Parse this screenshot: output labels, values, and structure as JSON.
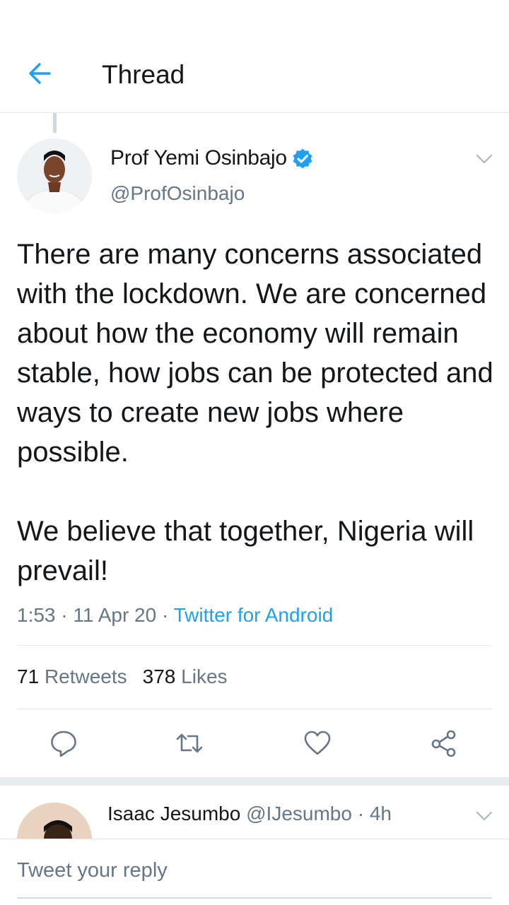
{
  "header": {
    "title": "Thread"
  },
  "tweet": {
    "author": {
      "name": "Prof Yemi Osinbajo",
      "handle": "@ProfOsinbajo",
      "verified": true
    },
    "paragraphs": [
      "There are many concerns associated with the lockdown. We are concerned about how the economy will remain stable, how jobs can be protected and ways to create new jobs where possible.",
      "We believe that together, Nigeria will prevail!"
    ],
    "meta": {
      "time": "1:53",
      "date": "11 Apr 20",
      "source": "Twitter for Android",
      "separator": "·"
    },
    "stats": {
      "retweets_count": "71",
      "retweets_label": "Retweets",
      "likes_count": "378",
      "likes_label": "Likes"
    },
    "actions": [
      "reply-icon",
      "retweet-icon",
      "like-icon",
      "share-icon"
    ]
  },
  "reply": {
    "name": "Isaac Jesumbo",
    "handle": "@IJesumbo",
    "separator": "·",
    "age": "4h"
  },
  "compose": {
    "placeholder": "Tweet your reply"
  },
  "colors": {
    "accent": "#1da1f2",
    "secondary_text": "#657786",
    "divider": "#e1e8ed",
    "text": "#14171a"
  }
}
